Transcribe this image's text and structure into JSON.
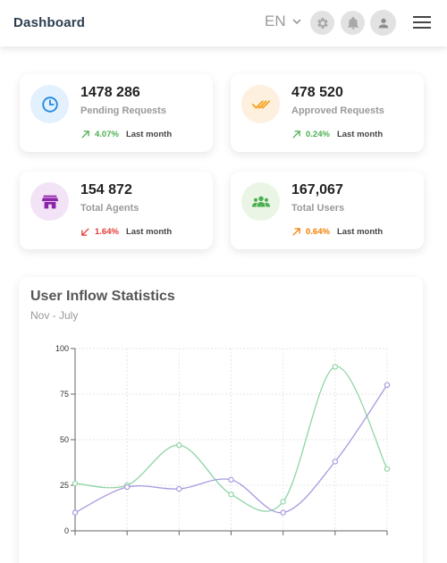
{
  "header": {
    "title": "Dashboard",
    "language": "EN",
    "icons": [
      "gear-icon",
      "bell-icon",
      "user-icon",
      "menu-icon"
    ]
  },
  "stats": [
    {
      "value": "1478 286",
      "label": "Pending Requests",
      "change": "4.07%",
      "period": "Last month",
      "direction": "up",
      "trend_color": "#4caf50",
      "icon": "clock-icon",
      "icon_color": "#1e88e5",
      "icon_bg": "#e3f0fd"
    },
    {
      "value": "478 520",
      "label": "Approved Requests",
      "change": "0.24%",
      "period": "Last month",
      "direction": "up",
      "trend_color": "#4caf50",
      "icon": "double-check-icon",
      "icon_color": "#f5a623",
      "icon_bg": "#fdf0df"
    },
    {
      "value": "154 872",
      "label": "Total Agents",
      "change": "1.64%",
      "period": "Last month",
      "direction": "down",
      "trend_color": "#e53935",
      "icon": "store-icon",
      "icon_color": "#8e24aa",
      "icon_bg": "#f3e3f6"
    },
    {
      "value": "167,067",
      "label": "Total Users",
      "change": "0.64%",
      "period": "Last month",
      "direction": "up",
      "trend_color": "#f57c00",
      "icon": "users-icon",
      "icon_color": "#4caf50",
      "icon_bg": "#eaf5e6"
    }
  ],
  "chart_section": {
    "title": "User Inflow Statistics",
    "subtitle": "Nov - July"
  },
  "chart_data": {
    "type": "line",
    "title": "User Inflow Statistics",
    "subtitle": "Nov - July",
    "x": [
      0,
      1,
      2,
      3,
      4,
      5,
      6
    ],
    "ylim": [
      0,
      100
    ],
    "yticks": [
      0,
      25,
      50,
      75,
      100
    ],
    "grid": true,
    "series": [
      {
        "color": "#8ed5a6",
        "values": [
          26,
          25,
          47,
          20,
          16,
          90,
          34
        ]
      },
      {
        "color": "#a99ae0",
        "values": [
          10,
          24,
          23,
          28,
          10,
          38,
          80
        ]
      }
    ]
  }
}
